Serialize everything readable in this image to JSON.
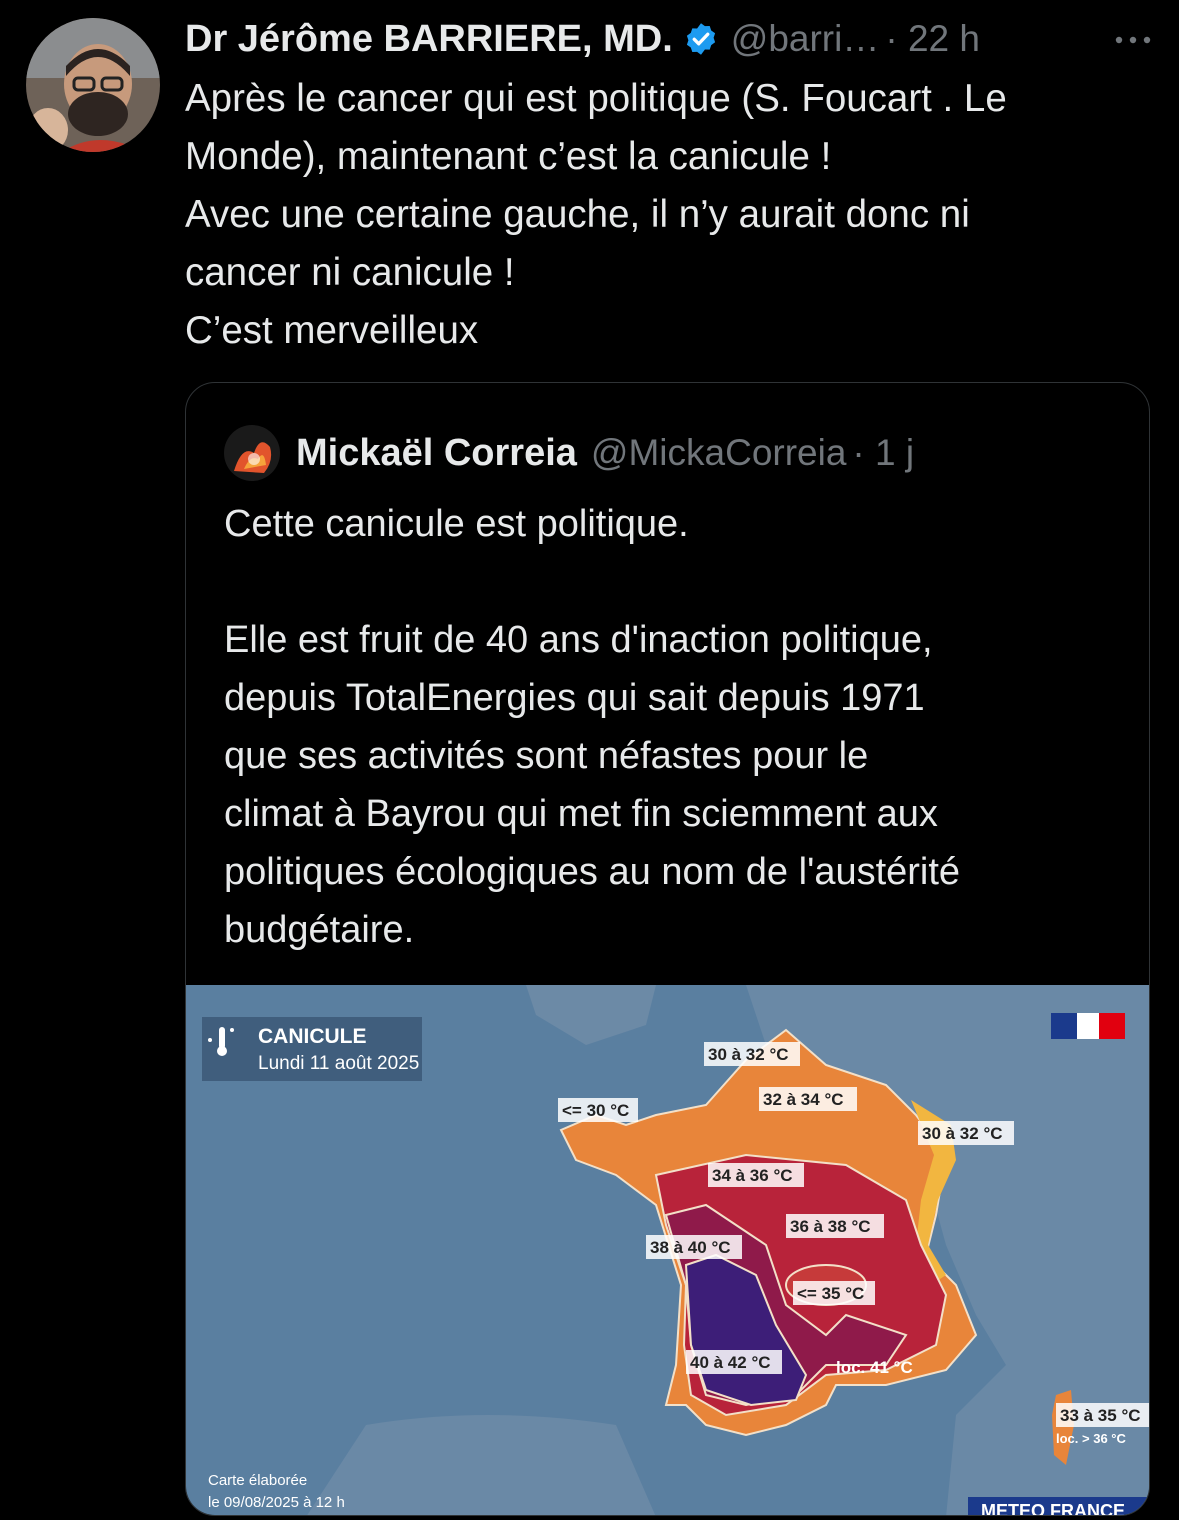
{
  "tweet": {
    "author_name": "Dr Jérôme BARRIERE, MD.",
    "author_handle": "@barri…",
    "time": "· 22 h",
    "verified_icon": "verified-badge-icon",
    "more_icon": "more-options-icon",
    "lines": [
      "Après le cancer qui est politique (S. Foucart . Le",
      "Monde), maintenant c’est la canicule !",
      "Avec une certaine gauche, il n’y aurait donc ni",
      "cancer ni canicule !",
      "C’est merveilleux"
    ]
  },
  "quoted": {
    "author_name": "Mickaël Correia",
    "author_handle": "@MickaCorreia",
    "time": "· 1 j",
    "lines": [
      "Cette canicule est politique.",
      "",
      "Elle est fruit de 40 ans d'inaction politique,",
      "depuis TotalEnergies qui sait depuis 1971",
      "que ses activités sont néfastes pour le",
      "climat à Bayrou qui met fin sciemment aux",
      "politiques écologiques au nom de l'austérité",
      "budgétaire."
    ]
  },
  "map": {
    "title": "CANICULE",
    "date": "Lundi 11 août 2025",
    "footer_line1": "Carte élaborée",
    "footer_line2": "le 09/08/2025 à 12 h",
    "brand": "METEO FRANCE",
    "labels": {
      "north_coast": "30 à 32 °C",
      "brittany": "<= 30 °C",
      "north_inland": "32 à 34 °C",
      "east": "30 à 32 °C",
      "center": "34 à 36 °C",
      "center_east": "36 à 38 °C",
      "west": "38 à 40 °C",
      "massif": "<= 35 °C",
      "southwest": "40 à 42 °C",
      "south_local": "loc. 41 °C",
      "corsica": "33 à 35 °C",
      "corsica_local": "loc. > 36 °C"
    },
    "colors": {
      "sea": "#5a7fa0",
      "orange": "#e8853a",
      "red": "#b8233a",
      "crimson": "#8f1a4a",
      "purple": "#3d1e78",
      "yellow": "#f2b640"
    }
  }
}
